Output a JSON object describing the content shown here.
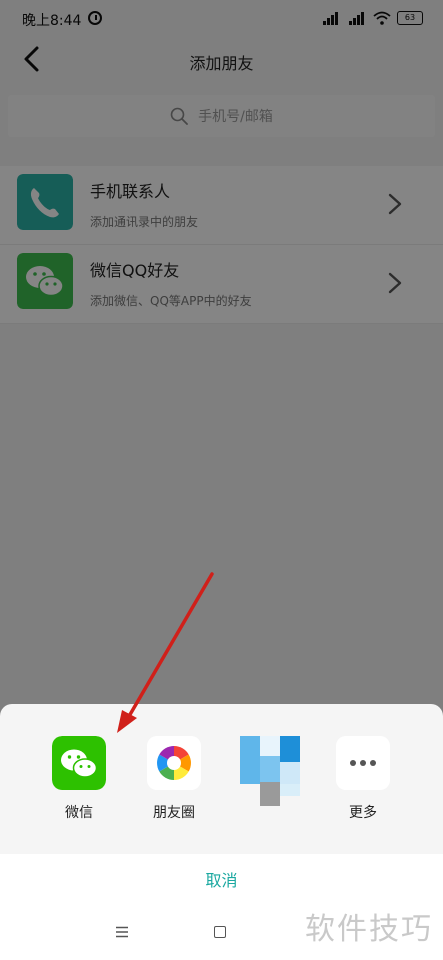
{
  "status_bar": {
    "time": "晚上8:44",
    "battery": "63"
  },
  "header": {
    "title": "添加朋友"
  },
  "search": {
    "placeholder": "手机号/邮箱"
  },
  "list": [
    {
      "title": "手机联系人",
      "subtitle": "添加通讯录中的朋友",
      "icon": "phone-icon"
    },
    {
      "title": "微信QQ好友",
      "subtitle": "添加微信、QQ等APP中的好友",
      "icon": "wechat-icon"
    }
  ],
  "share_sheet": {
    "items": [
      {
        "label": "微信",
        "icon": "wechat-icon"
      },
      {
        "label": "朋友圈",
        "icon": "moments-icon"
      },
      {
        "label": "",
        "icon": "blurred-app-icon"
      },
      {
        "label": "更多",
        "icon": "more-icon"
      }
    ],
    "cancel_label": "取消"
  },
  "watermark": "软件技巧",
  "colors": {
    "accent": "#1aa8a0",
    "wechat_green": "#2dc100",
    "arrow_red": "#d0201a"
  }
}
